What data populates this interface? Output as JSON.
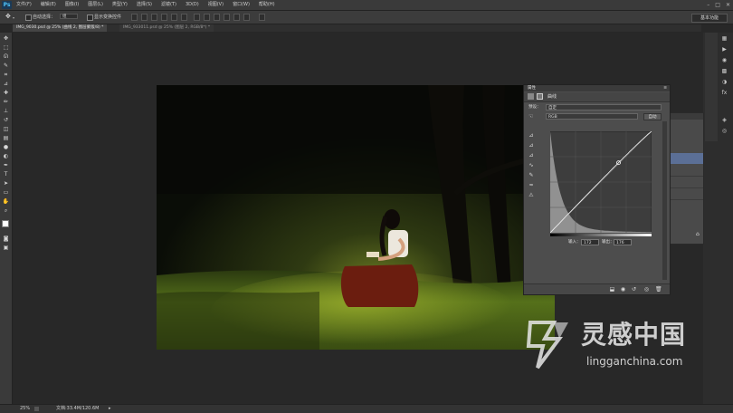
{
  "app": {
    "logo": "Ps",
    "menus": [
      "文件(F)",
      "编辑(E)",
      "图像(I)",
      "图层(L)",
      "类型(Y)",
      "选择(S)",
      "滤镜(T)",
      "3D(D)",
      "视图(V)",
      "窗口(W)",
      "帮助(H)"
    ],
    "window_controls": [
      "–",
      "□",
      "✕"
    ]
  },
  "options_bar": {
    "auto_select_label": "自动选择：",
    "auto_select_value": "组",
    "show_transform_label": "显示变换控件",
    "workspace": "基本功能"
  },
  "tabs": [
    {
      "label": "IMG_9030.psd @ 25% (曲线 2, 图层蒙版/8) *",
      "active": true
    },
    {
      "label": "IMG_933011.psd @ 25% (图层 2, RGB/8*) *",
      "active": false
    }
  ],
  "status_bar": {
    "zoom": "25%",
    "doc_size": "文档:33.4M/120.6M"
  },
  "properties_panel": {
    "title": "属性",
    "panel_name": "曲线",
    "preset_label": "预设：",
    "preset_value": "自定",
    "channel_value": "RGB",
    "auto_button": "自动",
    "input_label": "输入：",
    "input_value": "172",
    "output_label": "输出：",
    "output_value": "176",
    "curve_point": {
      "input": 172,
      "output": 176
    }
  },
  "watermark": {
    "brand": "灵感中国",
    "url": "lingganchina.com"
  },
  "colors": {
    "accent": "#5b6f96",
    "panel": "#4d4d4d",
    "background": "#282828"
  }
}
